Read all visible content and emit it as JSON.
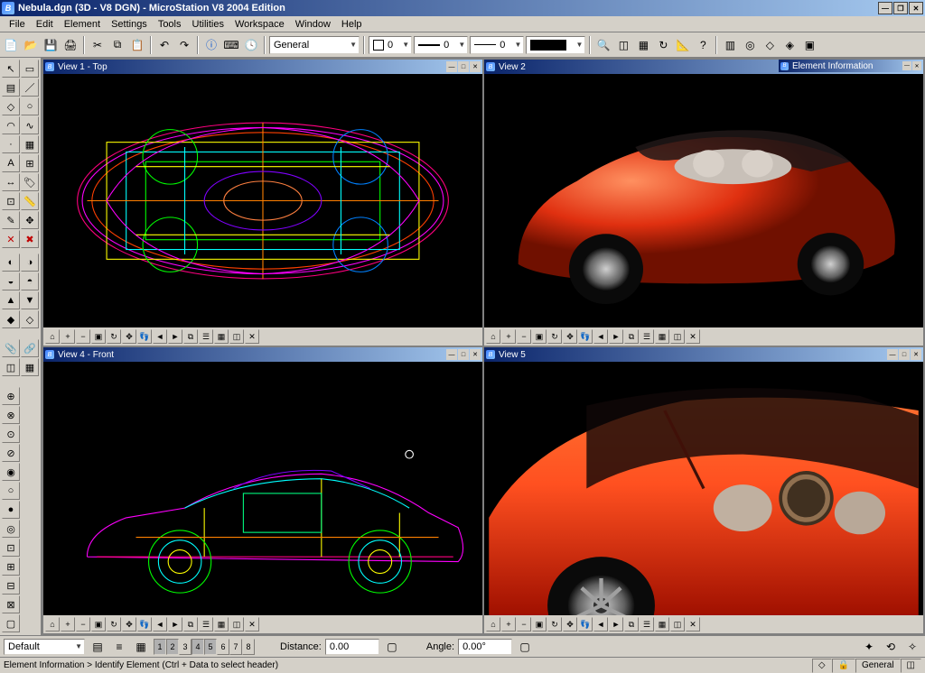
{
  "titlebar": "Nebula.dgn (3D - V8 DGN) - MicroStation V8 2004 Edition",
  "menu": [
    "File",
    "Edit",
    "Element",
    "Settings",
    "Tools",
    "Utilities",
    "Workspace",
    "Window",
    "Help"
  ],
  "toolbar_attributes": {
    "level": "General",
    "color_value": "0",
    "linestyle_value": "0",
    "lineweight_value": "0"
  },
  "viewports": {
    "v1": {
      "title": "View 1 - Top"
    },
    "v2": {
      "title": "View 2"
    },
    "v4": {
      "title": "View 4 - Front"
    },
    "v5": {
      "title": "View 5"
    },
    "element_info_title": "Element Information"
  },
  "bottom": {
    "level_combo": "Default",
    "view_buttons": [
      "1",
      "2",
      "3",
      "4",
      "5",
      "6",
      "7",
      "8"
    ],
    "active_views": [
      "1",
      "2",
      "4",
      "5"
    ],
    "distance_label": "Distance:",
    "distance_value": "0.00",
    "angle_label": "Angle:",
    "angle_value": "0.00°",
    "snap_label": "General"
  },
  "statusbar": "Element Information > Identify Element (Ctrl + Data to select header)"
}
